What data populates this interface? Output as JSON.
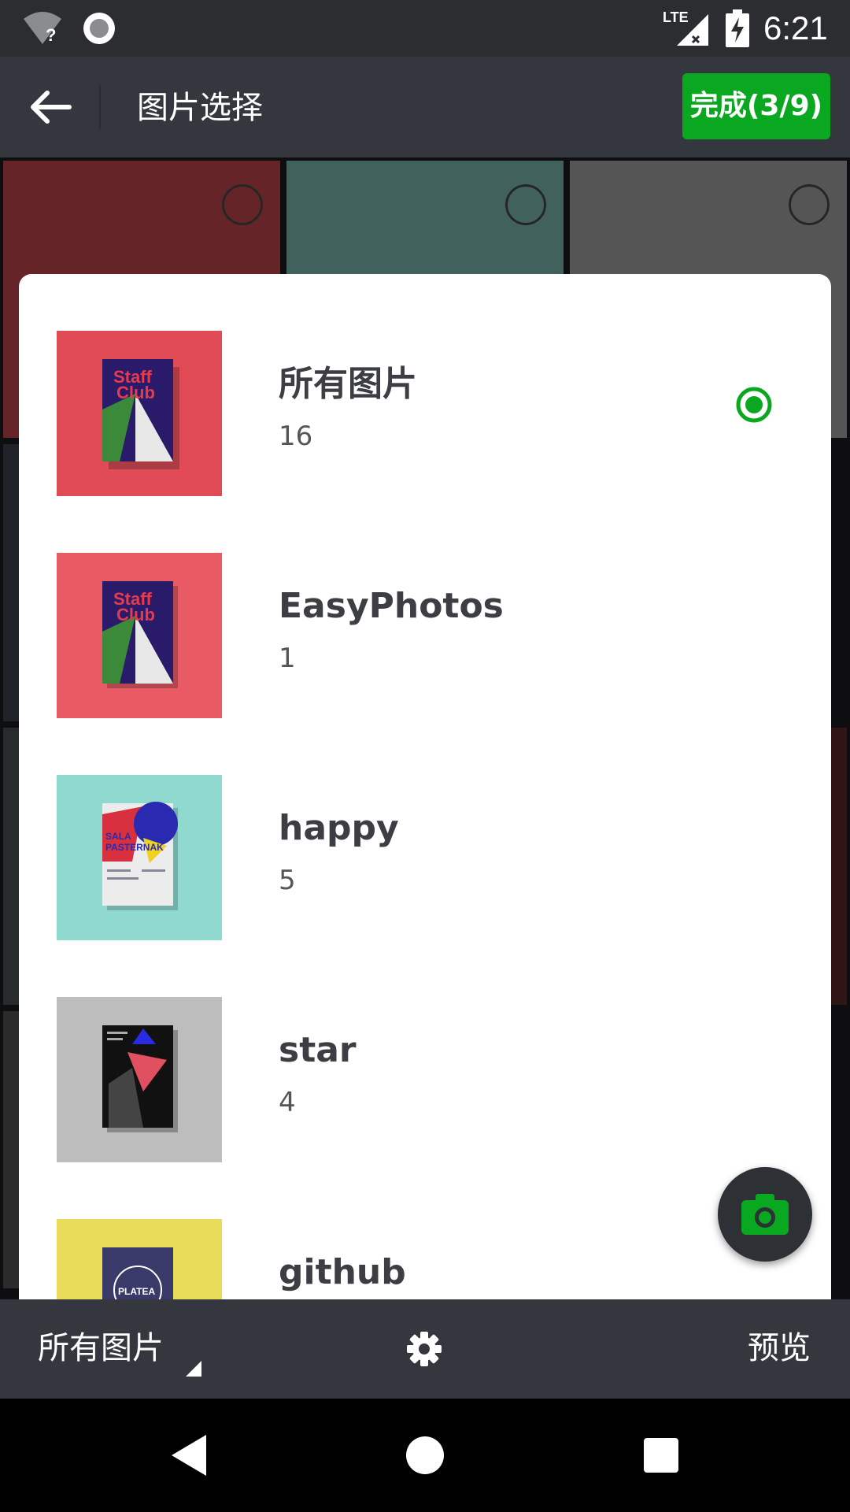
{
  "status_bar": {
    "time": "6:21",
    "network": "LTE",
    "icons": [
      "wifi-unknown-icon",
      "record-icon",
      "lte-signal-icon",
      "battery-charging-icon"
    ]
  },
  "header": {
    "title": "图片选择",
    "done_label": "完成(3/9)"
  },
  "folders": [
    {
      "name": "所有图片",
      "count": "16",
      "selected": true
    },
    {
      "name": "EasyPhotos",
      "count": "1",
      "selected": false
    },
    {
      "name": "happy",
      "count": "5",
      "selected": false
    },
    {
      "name": "star",
      "count": "4",
      "selected": false
    },
    {
      "name": "github",
      "count": "",
      "selected": false
    }
  ],
  "bottom_bar": {
    "album_label": "所有图片",
    "preview_label": "预览"
  },
  "colors": {
    "accent": "#0aa820",
    "toolbar": "#34373d",
    "status_bar": "#2b2d31"
  }
}
